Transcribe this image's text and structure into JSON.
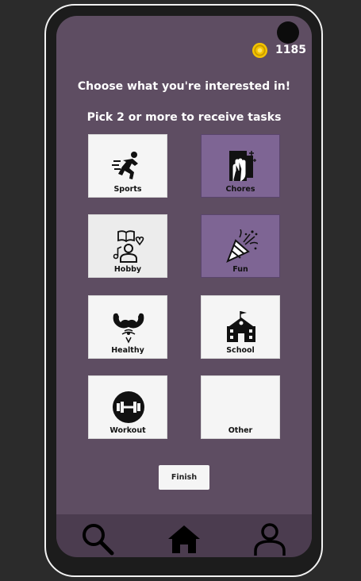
{
  "header": {
    "coins": "1185"
  },
  "prompt": {
    "title": "Choose what you're interested in!",
    "subtitle": "Pick 2 or more to receive tasks"
  },
  "interests": [
    {
      "label": "Sports",
      "icon": "running-person-icon",
      "selected": false
    },
    {
      "label": "Chores",
      "icon": "cleaning-hand-icon",
      "selected": true
    },
    {
      "label": "Hobby",
      "icon": "hobby-person-icon",
      "selected": false
    },
    {
      "label": "Fun",
      "icon": "party-popper-icon",
      "selected": true
    },
    {
      "label": "Healthy",
      "icon": "muscle-arms-icon",
      "selected": false
    },
    {
      "label": "School",
      "icon": "school-building-icon",
      "selected": false
    },
    {
      "label": "Workout",
      "icon": "dumbbell-icon",
      "selected": false
    },
    {
      "label": "Other",
      "icon": "",
      "selected": false
    }
  ],
  "actions": {
    "finish_label": "Finish"
  },
  "nav": {
    "items": [
      {
        "name": "search",
        "icon": "search-icon"
      },
      {
        "name": "home",
        "icon": "home-icon"
      },
      {
        "name": "profile",
        "icon": "user-icon"
      }
    ]
  },
  "colors": {
    "screen_bg": "#5e4d62",
    "selected_tile": "#7e6594",
    "tile": "#f5f5f5",
    "coin": "#f3c400"
  }
}
